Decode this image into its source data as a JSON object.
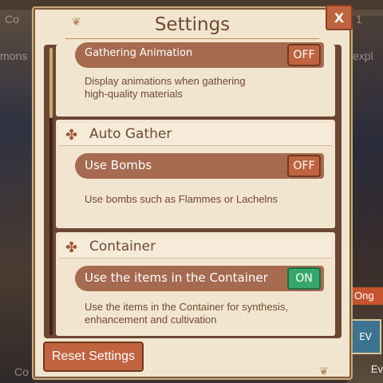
{
  "title": "Settings",
  "close_label": "X",
  "background": {
    "top_left": "Co",
    "top_left2": "mons",
    "top_right": "1",
    "top_right2": "expl",
    "badge": "Ong",
    "ev_tile": "EV",
    "ev_label": "Ev",
    "bottom_left": "Co"
  },
  "sections": [
    {
      "title": "",
      "rows": [
        {
          "label": "Gathering Animation",
          "state": "OFF",
          "on": false,
          "description": [
            "Display animations when gathering",
            "high-quality materials"
          ]
        }
      ]
    },
    {
      "title": "Auto Gather",
      "rows": [
        {
          "label": "Use Bombs",
          "state": "OFF",
          "on": false,
          "description": [
            "Use bombs such as Flammes or Lachelns"
          ]
        }
      ]
    },
    {
      "title": "Container",
      "rows": [
        {
          "label": "Use the items in the Container",
          "state": "ON",
          "on": true,
          "description": [
            "Use the items in the Container for synthesis,",
            "enhancement and cultivation"
          ]
        }
      ]
    }
  ],
  "reset_label": "Reset Settings",
  "colors": {
    "panel": "#f2e5cf",
    "accent": "#c0633f",
    "on": "#37a86b",
    "text": "#6e4a33"
  }
}
